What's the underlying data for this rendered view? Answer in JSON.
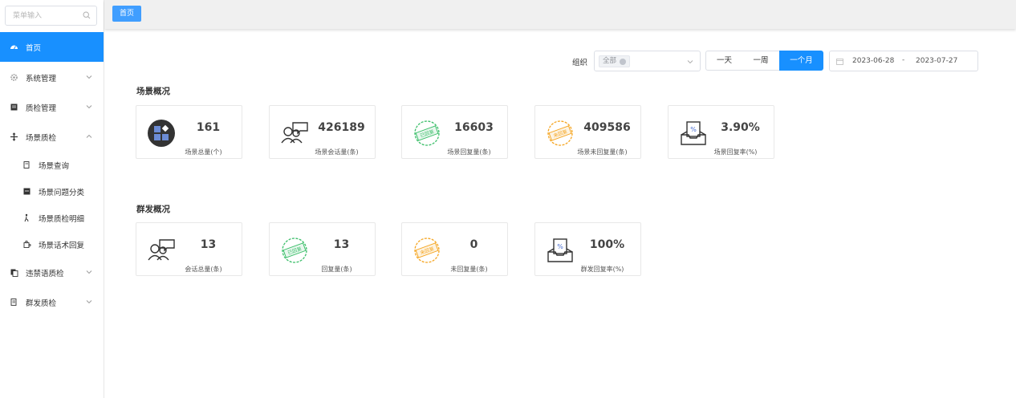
{
  "sidebar": {
    "search_placeholder": "菜单输入",
    "items": [
      {
        "label": "首页"
      },
      {
        "label": "系统管理"
      },
      {
        "label": "质检管理"
      },
      {
        "label": "场景质检"
      },
      {
        "label": "场景查询"
      },
      {
        "label": "场景问题分类"
      },
      {
        "label": "场景质检明细"
      },
      {
        "label": "场景话术回复"
      },
      {
        "label": "违禁语质检"
      },
      {
        "label": "群发质检"
      }
    ]
  },
  "topbar": {
    "tag_label": "首页"
  },
  "filters": {
    "org_label": "组织",
    "org_chip": "全部",
    "ranges": [
      "一天",
      "一周",
      "一个月"
    ],
    "start_date": "2023-06-28",
    "separator": "-",
    "end_date": "2023-07-27"
  },
  "scene": {
    "title": "场景概况",
    "cards": [
      {
        "value": "161",
        "label": "场景总量(个)"
      },
      {
        "value": "426189",
        "label": "场景会话量(条)"
      },
      {
        "value": "16603",
        "label": "场景回复量(条)"
      },
      {
        "value": "409586",
        "label": "场景未回复量(条)"
      },
      {
        "value": "3.90%",
        "label": "场景回复率(%)"
      }
    ]
  },
  "group": {
    "title": "群发概况",
    "cards": [
      {
        "value": "13",
        "label": "会话总量(条)"
      },
      {
        "value": "13",
        "label": "回复量(条)"
      },
      {
        "value": "0",
        "label": "未回复量(条)"
      },
      {
        "value": "100%",
        "label": "群发回复率(%)"
      }
    ]
  },
  "stamp_text": {
    "replied": "已回复",
    "unreplied": "未回复"
  },
  "colors": {
    "primary": "#1890ff",
    "tag": "#409eff",
    "replied_green": "#3cbf6a",
    "unreplied_orange": "#f5a623"
  }
}
